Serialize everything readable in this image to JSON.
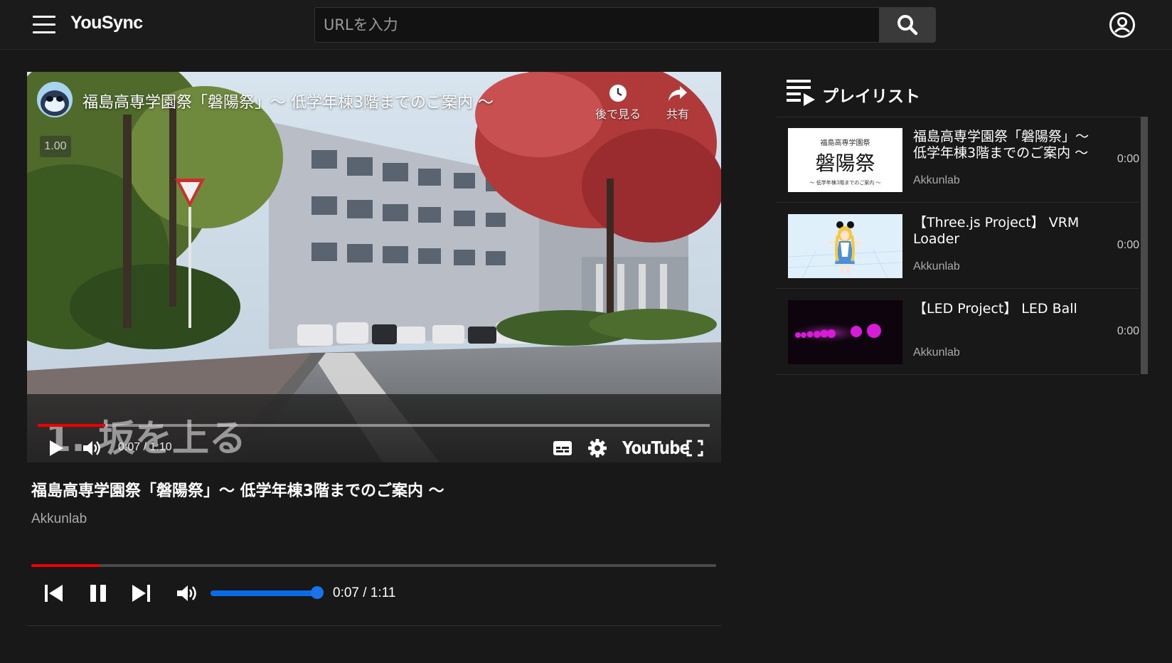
{
  "header": {
    "logo": "YouSync",
    "search_placeholder": "URLを入力"
  },
  "player": {
    "overlay_title": "福島高専学園祭「磐陽祭」～ 低学年棟3階までのご案内 ～",
    "watch_later_label": "後で見る",
    "share_label": "共有",
    "speed": "1.00",
    "chapter_text": "1. 坂を上る",
    "yt_time": "0:07 / 1:10",
    "yt_logo": "YouTube",
    "yt_progress_fraction": 0.1
  },
  "video_info": {
    "title": "福島高専学園祭「磐陽祭」～ 低学年棟3階までのご案内 ～",
    "channel": "Akkunlab"
  },
  "controls": {
    "time": "0:07 / 1:11",
    "progress_fraction": 0.1,
    "volume_fraction": 1.0
  },
  "playlist": {
    "title": "プレイリスト",
    "thumb1_top": "福島高専学園祭",
    "thumb1_main": "磐陽祭",
    "thumb1_sub": "～ 低学年棟3階までのご案内 ～",
    "items": [
      {
        "title": "福島高専学園祭「磐陽祭」～ 低学年棟3階までのご案内 ～",
        "channel": "Akkunlab",
        "duration": "0:00"
      },
      {
        "title": "【Three.js Project】 VRM Loader",
        "channel": "Akkunlab",
        "duration": "0:00"
      },
      {
        "title": "【LED Project】 LED Ball",
        "channel": "Akkunlab",
        "duration": "0:00"
      }
    ]
  }
}
